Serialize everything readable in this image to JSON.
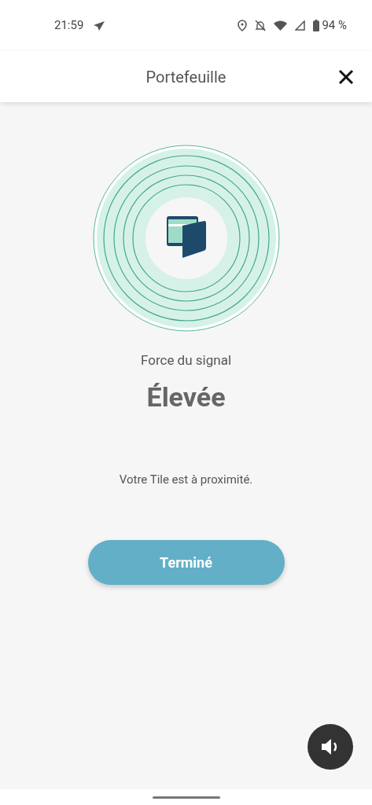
{
  "status_bar": {
    "time": "21:59",
    "battery": "94 %"
  },
  "header": {
    "title": "Portefeuille"
  },
  "signal": {
    "label": "Force du signal",
    "value": "Élevée"
  },
  "message": "Votre Tile est à proximité.",
  "done_button": {
    "label": "Terminé"
  }
}
